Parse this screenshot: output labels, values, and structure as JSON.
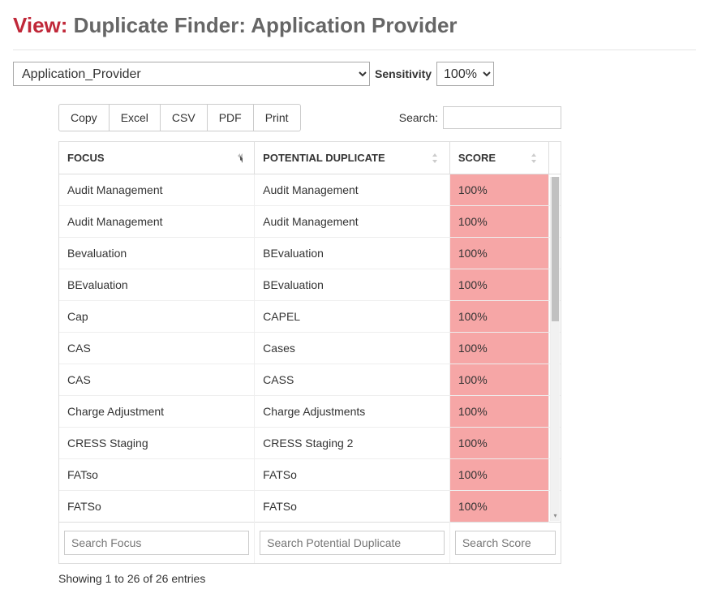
{
  "heading": {
    "prefix": "View:",
    "title": "Duplicate Finder: Application Provider"
  },
  "controls": {
    "entity_selected": "Application_Provider",
    "sensitivity_label": "Sensitivity",
    "sensitivity_selected": "100%"
  },
  "toolbar": {
    "buttons": {
      "copy": "Copy",
      "excel": "Excel",
      "csv": "CSV",
      "pdf": "PDF",
      "print": "Print"
    },
    "search_label": "Search:"
  },
  "columns": {
    "focus": "FOCUS",
    "duplicate": "POTENTIAL DUPLICATE",
    "score": "SCORE"
  },
  "foot_placeholders": {
    "focus": "Search Focus",
    "duplicate": "Search Potential Duplicate",
    "score": "Search Score"
  },
  "info_text": "Showing 1 to 26 of 26 entries",
  "score_highlight_bg": "#f6a6a6",
  "rows": [
    {
      "focus": "Audit Management",
      "dup": "Audit Management",
      "score": "100%"
    },
    {
      "focus": "Audit Management",
      "dup": "Audit Management",
      "score": "100%"
    },
    {
      "focus": "Bevaluation",
      "dup": "BEvaluation",
      "score": "100%"
    },
    {
      "focus": "BEvaluation",
      "dup": "BEvaluation",
      "score": "100%"
    },
    {
      "focus": "Cap",
      "dup": "CAPEL",
      "score": "100%"
    },
    {
      "focus": "CAS",
      "dup": "Cases",
      "score": "100%"
    },
    {
      "focus": "CAS",
      "dup": "CASS",
      "score": "100%"
    },
    {
      "focus": "Charge Adjustment",
      "dup": "Charge Adjustments",
      "score": "100%"
    },
    {
      "focus": "CRESS Staging",
      "dup": "CRESS Staging 2",
      "score": "100%"
    },
    {
      "focus": "FATso",
      "dup": "FATSo",
      "score": "100%"
    },
    {
      "focus": "FATSo",
      "dup": "FATSo",
      "score": "100%"
    }
  ]
}
